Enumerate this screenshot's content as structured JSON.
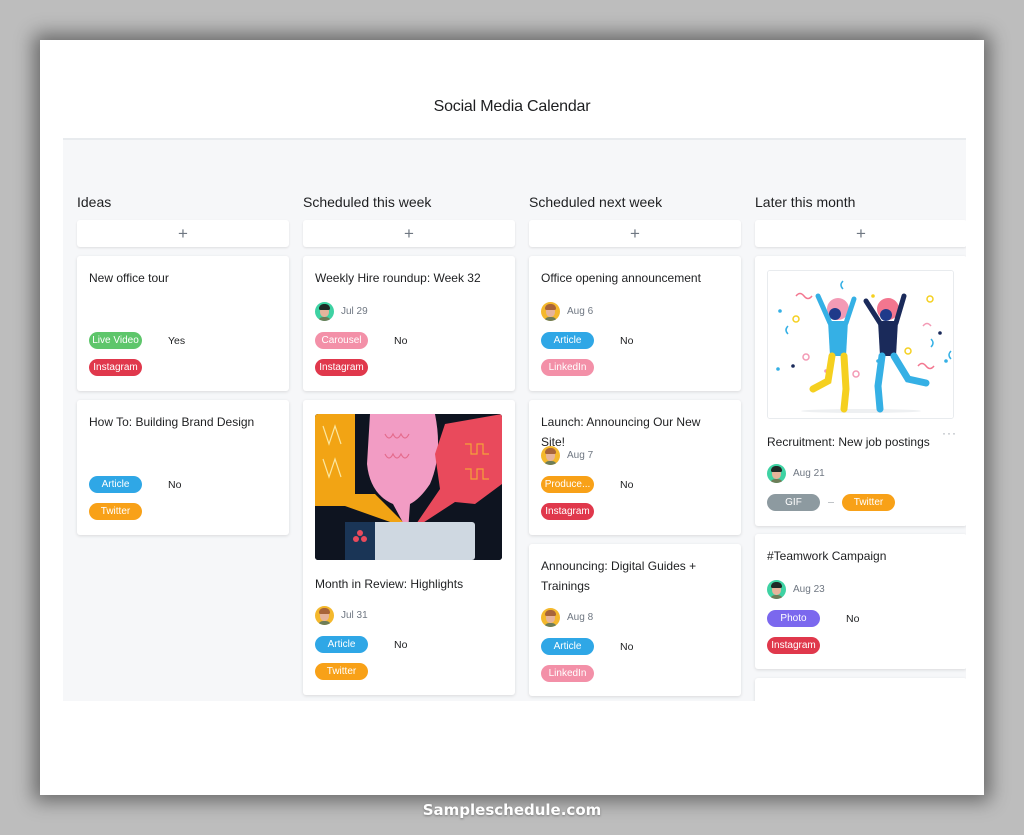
{
  "page": {
    "title": "Social Media Calendar",
    "watermark": "Sampleschedule.com"
  },
  "icons": {
    "add": "plus-icon",
    "more": "ellipsis-icon"
  },
  "add_label": "+",
  "more_label": "···",
  "colors": {
    "live_video": "#5ec66b",
    "instagram": "#e0384c",
    "article": "#2fa7e6",
    "twitter": "#f8a118",
    "carousel": "#f390a8",
    "linkedin": "#f390a8",
    "produce": "#f8a118",
    "gif": "#8d9aa0",
    "photo": "#7b68ee"
  },
  "columns": [
    {
      "title": "Ideas",
      "cards": [
        {
          "title": "New office tour",
          "format": "Live Video",
          "flag": "Yes",
          "channel": "Instagram"
        },
        {
          "title": "How To: Building Brand Design",
          "format": "Article",
          "flag": "No",
          "channel": "Twitter"
        }
      ]
    },
    {
      "title": "Scheduled this week",
      "cards": [
        {
          "title": "Weekly Hire roundup: Week 32",
          "date": "Jul 29",
          "format": "Carousel",
          "flag": "No",
          "channel": "Instagram"
        },
        {
          "title": "Month in Review: Highlights",
          "date": "Jul 31",
          "format": "Article",
          "flag": "No",
          "channel": "Twitter",
          "image": "speech-bubbles-illustration"
        }
      ]
    },
    {
      "title": "Scheduled next week",
      "cards": [
        {
          "title": "Office opening announcement",
          "date": "Aug 6",
          "format": "Article",
          "flag": "No",
          "channel": "LinkedIn"
        },
        {
          "title": "Launch: Announcing Our New Site!",
          "date": "Aug 7",
          "format": "Produce...",
          "flag": "No",
          "channel": "Instagram"
        },
        {
          "title": "Announcing: Digital Guides + Trainings",
          "date": "Aug 8",
          "format": "Article",
          "flag": "No",
          "channel": "LinkedIn"
        }
      ]
    },
    {
      "title": "Later this month",
      "cards": [
        {
          "title": "Recruitment: New job postings",
          "date": "Aug 21",
          "format": "GIF",
          "flag": "—",
          "channel": "Twitter",
          "image": "celebration-illustration"
        },
        {
          "title": "#Teamwork Campaign",
          "date": "Aug 23",
          "format": "Photo",
          "flag": "No",
          "channel": "Instagram"
        }
      ]
    }
  ]
}
